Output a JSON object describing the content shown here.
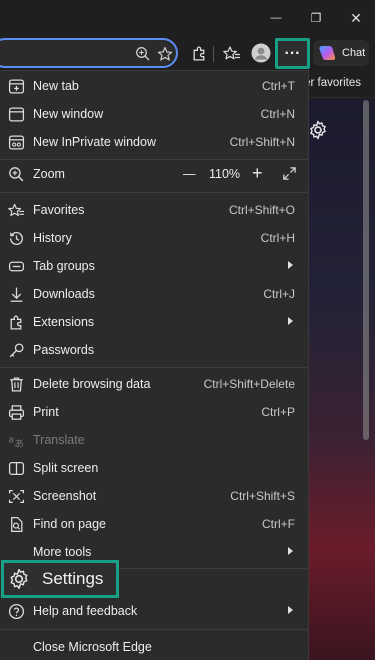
{
  "titlebar": {
    "minimize_glyph": "—",
    "restore_glyph": "❐",
    "close_glyph": "✕"
  },
  "toolbar": {
    "more_label": "···",
    "chat_label": "Chat"
  },
  "favorites_bar": {
    "text": "er favorites"
  },
  "menu": {
    "new_tab": {
      "label": "New tab",
      "shortcut": "Ctrl+T"
    },
    "new_window": {
      "label": "New window",
      "shortcut": "Ctrl+N"
    },
    "new_inprivate": {
      "label": "New InPrivate window",
      "shortcut": "Ctrl+Shift+N"
    },
    "zoom": {
      "label": "Zoom",
      "minus": "—",
      "value": "110%",
      "plus": "+"
    },
    "favorites": {
      "label": "Favorites",
      "shortcut": "Ctrl+Shift+O"
    },
    "history": {
      "label": "History",
      "shortcut": "Ctrl+H"
    },
    "tab_groups": {
      "label": "Tab groups"
    },
    "downloads": {
      "label": "Downloads",
      "shortcut": "Ctrl+J"
    },
    "extensions": {
      "label": "Extensions"
    },
    "passwords": {
      "label": "Passwords"
    },
    "delete_browsing": {
      "label": "Delete browsing data",
      "shortcut": "Ctrl+Shift+Delete"
    },
    "print": {
      "label": "Print",
      "shortcut": "Ctrl+P"
    },
    "translate": {
      "label": "Translate"
    },
    "split_screen": {
      "label": "Split screen"
    },
    "screenshot": {
      "label": "Screenshot",
      "shortcut": "Ctrl+Shift+S"
    },
    "find_on_page": {
      "label": "Find on page",
      "shortcut": "Ctrl+F"
    },
    "more_tools": {
      "label": "More tools"
    },
    "settings": {
      "label": "Settings"
    },
    "help": {
      "label": "Help and feedback"
    },
    "close_edge": {
      "label": "Close Microsoft Edge"
    }
  },
  "colors": {
    "highlight": "#17a086",
    "menu_bg": "#2b2b2b",
    "address_focus": "#5b8ef2"
  }
}
